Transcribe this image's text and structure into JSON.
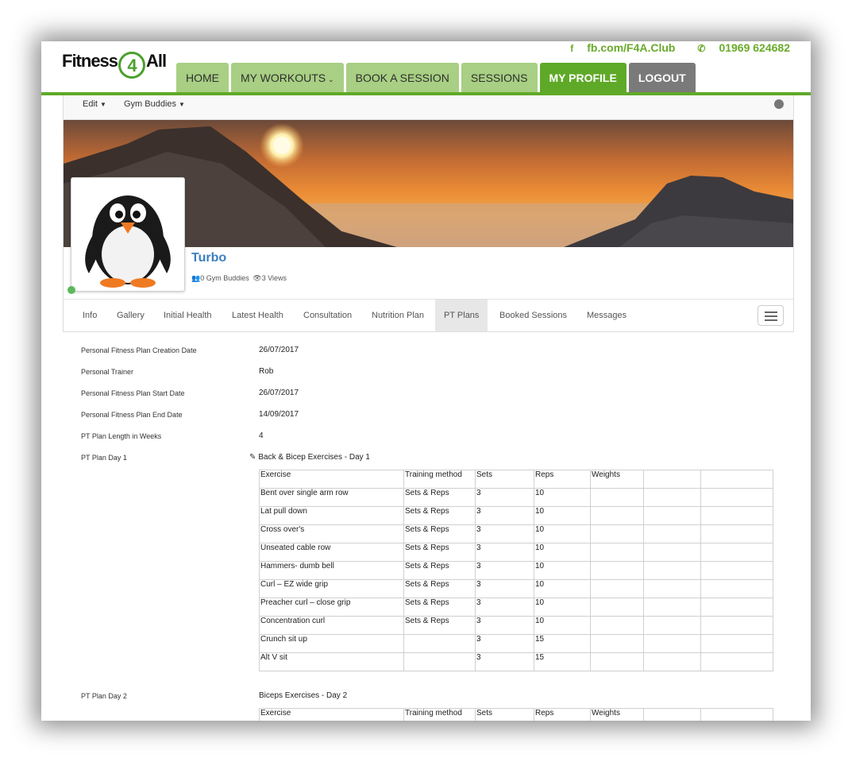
{
  "header": {
    "logo_left": "Fitness",
    "logo_mid": "4",
    "logo_right": "All",
    "facebook": "fb.com/F4A.Club",
    "phone": "01969 624682",
    "nav": [
      {
        "label": "HOME"
      },
      {
        "label": "MY WORKOUTS",
        "dropdown": true
      },
      {
        "label": "BOOK A SESSION"
      },
      {
        "label": "SESSIONS"
      },
      {
        "label": "MY PROFILE",
        "active": true
      },
      {
        "label": "LOGOUT"
      }
    ]
  },
  "toolbar": {
    "edit": "Edit",
    "buddies": "Gym Buddies"
  },
  "profile": {
    "name": "Turbo",
    "buddies_count": "0 Gym Buddies",
    "views": "3 Views"
  },
  "tabs": [
    "Info",
    "Gallery",
    "Initial Health",
    "Latest Health",
    "Consultation",
    "Nutrition Plan",
    "PT Plans",
    "Booked Sessions",
    "Messages"
  ],
  "active_tab": "PT Plans",
  "details": [
    {
      "label": "Personal Fitness Plan Creation Date",
      "value": "26/07/2017"
    },
    {
      "label": "Personal Trainer",
      "value": "Rob"
    },
    {
      "label": "Personal Fitness Plan Start Date",
      "value": "26/07/2017"
    },
    {
      "label": "Personal Fitness Plan End Date",
      "value": "14/09/2017"
    },
    {
      "label": "PT Plan Length in Weeks",
      "value": "4"
    }
  ],
  "day1": {
    "label": "PT Plan Day 1",
    "title": "Back & Bicep Exercises - Day 1",
    "headers": [
      "Exercise",
      "Training method",
      "Sets",
      "Reps",
      "Weights",
      "",
      ""
    ],
    "rows": [
      [
        "Bent over single arm row",
        "Sets & Reps",
        "3",
        "10",
        "",
        "",
        ""
      ],
      [
        "Lat pull down",
        "Sets & Reps",
        "3",
        "10",
        "",
        "",
        ""
      ],
      [
        "Cross over's",
        "Sets & Reps",
        "3",
        "10",
        "",
        "",
        ""
      ],
      [
        "Unseated cable row",
        "Sets & Reps",
        "3",
        "10",
        "",
        "",
        ""
      ],
      [
        "Hammers- dumb bell",
        "Sets & Reps",
        "3",
        "10",
        "",
        "",
        ""
      ],
      [
        "Curl – EZ wide grip",
        "Sets & Reps",
        "3",
        "10",
        "",
        "",
        ""
      ],
      [
        "Preacher curl – close grip",
        "Sets & Reps",
        "3",
        "10",
        "",
        "",
        ""
      ],
      [
        "Concentration curl",
        "Sets & Reps",
        "3",
        "10",
        "",
        "",
        ""
      ],
      [
        "Crunch sit up",
        "",
        "3",
        "15",
        "",
        "",
        ""
      ],
      [
        "Alt V sit",
        "",
        "3",
        "15",
        "",
        "",
        ""
      ]
    ]
  },
  "day2": {
    "label": "PT Plan Day 2",
    "title": "Biceps Exercises - Day 2",
    "headers": [
      "Exercise",
      "Training method",
      "Sets",
      "Reps",
      "Weights",
      "",
      ""
    ]
  },
  "colors": {
    "brand_green": "#5fa928",
    "nav_green_light": "#a8cf83",
    "logout_gray": "#7a7a7a",
    "name_blue": "#3a7fc1",
    "contact_green": "#6aaa2b"
  }
}
